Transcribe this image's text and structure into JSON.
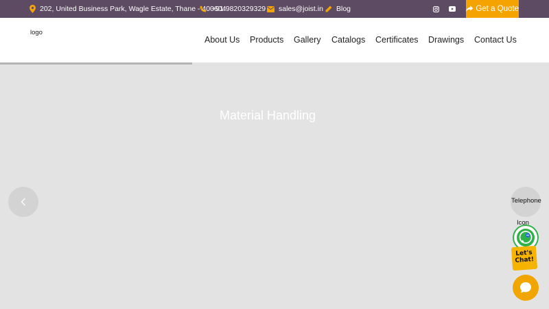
{
  "topbar": {
    "address": "202, United Business Park, Wagle Estate, Thane - 400604",
    "phone": "+91 9820329329",
    "email": "sales@joist.in",
    "blog": "Blog",
    "quote_label": "Get a Quote",
    "social": [
      "instagram-icon",
      "youtube-icon"
    ]
  },
  "header": {
    "logo_alt": "logo",
    "nav": {
      "about": "About Us",
      "products": "Products",
      "gallery": "Gallery",
      "catalogs": "Catalogs",
      "certificates": "Certificates",
      "drawings": "Drawings",
      "contact": "Contact Us"
    }
  },
  "hero": {
    "slide_title": "Material Handling",
    "progress": 0.35
  },
  "widgets": {
    "telephone_alt": "Telephone",
    "icon_alt": "Icon",
    "chat_sticker": "Let's Chat!"
  },
  "colors": {
    "topbar_bg": "#5d4a63",
    "accent": "#f5a300",
    "hero_bg": "#e3e3e3"
  }
}
